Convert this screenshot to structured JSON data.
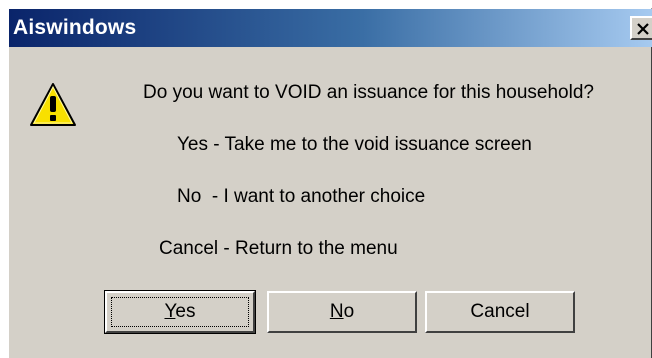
{
  "window": {
    "title": "Aiswindows",
    "close_glyph": "✕"
  },
  "icon": {
    "name": "warning-icon",
    "color": "#f8e000"
  },
  "messages": {
    "question": "Do you want to VOID an issuance for this household?",
    "yes_option": "Yes - Take me to the void issuance screen",
    "no_option": "No  - I want to another choice",
    "cancel_option": "Cancel - Return to the menu"
  },
  "buttons": {
    "yes": {
      "mnemonic": "Y",
      "rest": "es"
    },
    "no": {
      "mnemonic": "N",
      "rest": "o"
    },
    "cancel": {
      "label": "Cancel"
    }
  }
}
